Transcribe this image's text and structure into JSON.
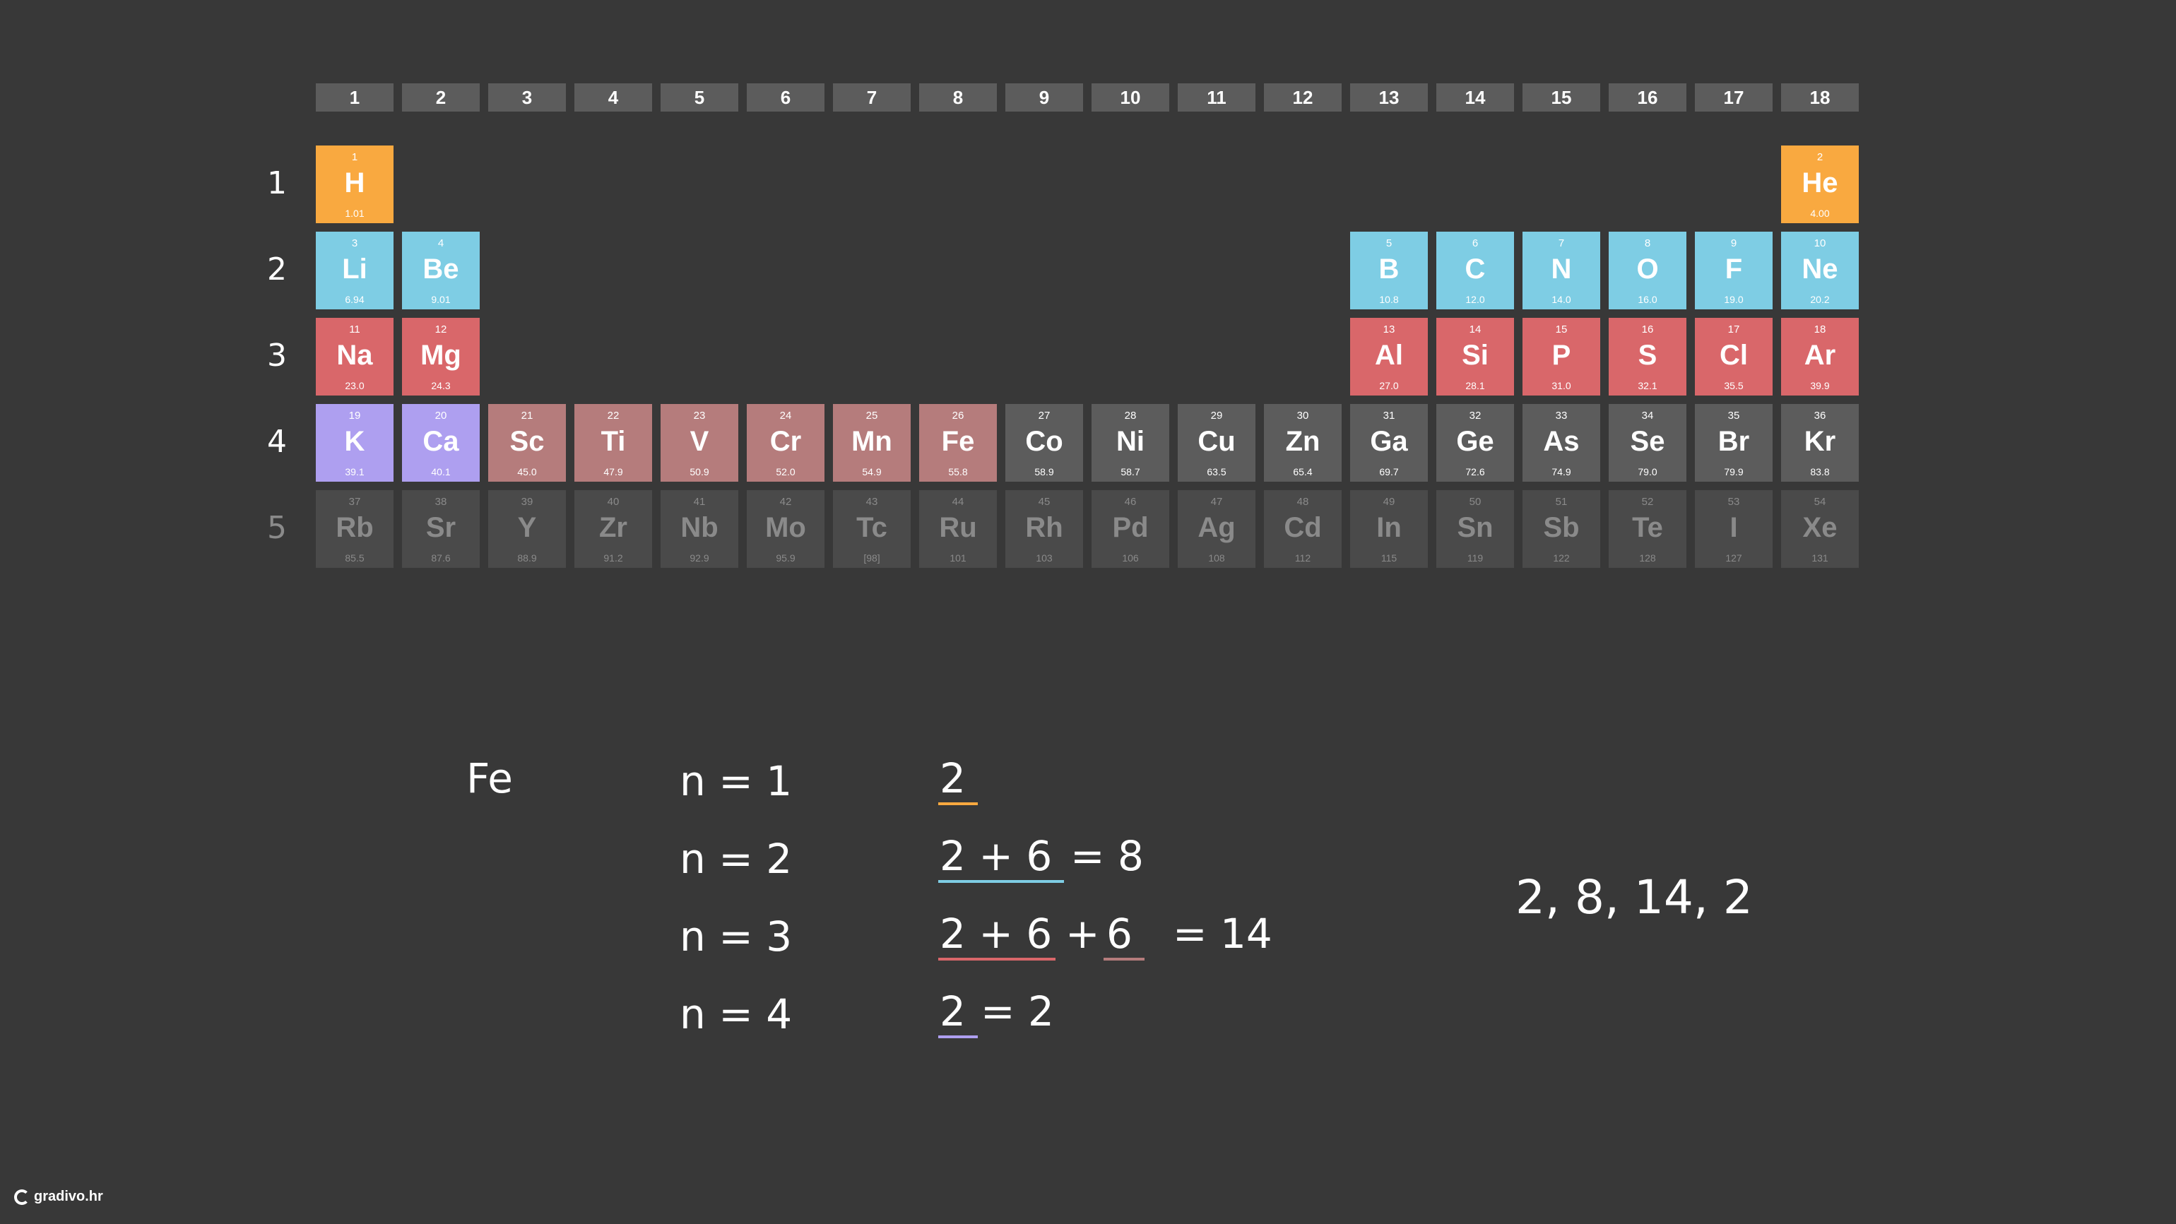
{
  "colors": {
    "background": "#383838",
    "header": "#5c5c5c",
    "orange": "#f9a940",
    "blue": "#7ecde4",
    "red": "#d9676a",
    "purple": "#ae9ff0",
    "rose": "#b57c7c",
    "gray": "#5c5c5c",
    "dimgray": "#4a4a4a"
  },
  "groups": [
    "1",
    "2",
    "3",
    "4",
    "5",
    "6",
    "7",
    "8",
    "9",
    "10",
    "11",
    "12",
    "13",
    "14",
    "15",
    "16",
    "17",
    "18"
  ],
  "periods": [
    "1",
    "2",
    "3",
    "4",
    "5"
  ],
  "elements": [
    {
      "num": "1",
      "sym": "H",
      "mass": "1.01",
      "period": 1,
      "group": 1,
      "color": "orange"
    },
    {
      "num": "2",
      "sym": "He",
      "mass": "4.00",
      "period": 1,
      "group": 18,
      "color": "orange"
    },
    {
      "num": "3",
      "sym": "Li",
      "mass": "6.94",
      "period": 2,
      "group": 1,
      "color": "blue"
    },
    {
      "num": "4",
      "sym": "Be",
      "mass": "9.01",
      "period": 2,
      "group": 2,
      "color": "blue"
    },
    {
      "num": "5",
      "sym": "B",
      "mass": "10.8",
      "period": 2,
      "group": 13,
      "color": "blue"
    },
    {
      "num": "6",
      "sym": "C",
      "mass": "12.0",
      "period": 2,
      "group": 14,
      "color": "blue"
    },
    {
      "num": "7",
      "sym": "N",
      "mass": "14.0",
      "period": 2,
      "group": 15,
      "color": "blue"
    },
    {
      "num": "8",
      "sym": "O",
      "mass": "16.0",
      "period": 2,
      "group": 16,
      "color": "blue"
    },
    {
      "num": "9",
      "sym": "F",
      "mass": "19.0",
      "period": 2,
      "group": 17,
      "color": "blue"
    },
    {
      "num": "10",
      "sym": "Ne",
      "mass": "20.2",
      "period": 2,
      "group": 18,
      "color": "blue"
    },
    {
      "num": "11",
      "sym": "Na",
      "mass": "23.0",
      "period": 3,
      "group": 1,
      "color": "red"
    },
    {
      "num": "12",
      "sym": "Mg",
      "mass": "24.3",
      "period": 3,
      "group": 2,
      "color": "red"
    },
    {
      "num": "13",
      "sym": "Al",
      "mass": "27.0",
      "period": 3,
      "group": 13,
      "color": "red"
    },
    {
      "num": "14",
      "sym": "Si",
      "mass": "28.1",
      "period": 3,
      "group": 14,
      "color": "red"
    },
    {
      "num": "15",
      "sym": "P",
      "mass": "31.0",
      "period": 3,
      "group": 15,
      "color": "red"
    },
    {
      "num": "16",
      "sym": "S",
      "mass": "32.1",
      "period": 3,
      "group": 16,
      "color": "red"
    },
    {
      "num": "17",
      "sym": "Cl",
      "mass": "35.5",
      "period": 3,
      "group": 17,
      "color": "red"
    },
    {
      "num": "18",
      "sym": "Ar",
      "mass": "39.9",
      "period": 3,
      "group": 18,
      "color": "red"
    },
    {
      "num": "19",
      "sym": "K",
      "mass": "39.1",
      "period": 4,
      "group": 1,
      "color": "purple"
    },
    {
      "num": "20",
      "sym": "Ca",
      "mass": "40.1",
      "period": 4,
      "group": 2,
      "color": "purple"
    },
    {
      "num": "21",
      "sym": "Sc",
      "mass": "45.0",
      "period": 4,
      "group": 3,
      "color": "rose"
    },
    {
      "num": "22",
      "sym": "Ti",
      "mass": "47.9",
      "period": 4,
      "group": 4,
      "color": "rose"
    },
    {
      "num": "23",
      "sym": "V",
      "mass": "50.9",
      "period": 4,
      "group": 5,
      "color": "rose"
    },
    {
      "num": "24",
      "sym": "Cr",
      "mass": "52.0",
      "period": 4,
      "group": 6,
      "color": "rose"
    },
    {
      "num": "25",
      "sym": "Mn",
      "mass": "54.9",
      "period": 4,
      "group": 7,
      "color": "rose"
    },
    {
      "num": "26",
      "sym": "Fe",
      "mass": "55.8",
      "period": 4,
      "group": 8,
      "color": "rose"
    },
    {
      "num": "27",
      "sym": "Co",
      "mass": "58.9",
      "period": 4,
      "group": 9,
      "color": "gray"
    },
    {
      "num": "28",
      "sym": "Ni",
      "mass": "58.7",
      "period": 4,
      "group": 10,
      "color": "gray"
    },
    {
      "num": "29",
      "sym": "Cu",
      "mass": "63.5",
      "period": 4,
      "group": 11,
      "color": "gray"
    },
    {
      "num": "30",
      "sym": "Zn",
      "mass": "65.4",
      "period": 4,
      "group": 12,
      "color": "gray"
    },
    {
      "num": "31",
      "sym": "Ga",
      "mass": "69.7",
      "period": 4,
      "group": 13,
      "color": "gray"
    },
    {
      "num": "32",
      "sym": "Ge",
      "mass": "72.6",
      "period": 4,
      "group": 14,
      "color": "gray"
    },
    {
      "num": "33",
      "sym": "As",
      "mass": "74.9",
      "period": 4,
      "group": 15,
      "color": "gray"
    },
    {
      "num": "34",
      "sym": "Se",
      "mass": "79.0",
      "period": 4,
      "group": 16,
      "color": "gray"
    },
    {
      "num": "35",
      "sym": "Br",
      "mass": "79.9",
      "period": 4,
      "group": 17,
      "color": "gray"
    },
    {
      "num": "36",
      "sym": "Kr",
      "mass": "83.8",
      "period": 4,
      "group": 18,
      "color": "gray"
    },
    {
      "num": "37",
      "sym": "Rb",
      "mass": "85.5",
      "period": 5,
      "group": 1,
      "color": "dimgray"
    },
    {
      "num": "38",
      "sym": "Sr",
      "mass": "87.6",
      "period": 5,
      "group": 2,
      "color": "dimgray"
    },
    {
      "num": "39",
      "sym": "Y",
      "mass": "88.9",
      "period": 5,
      "group": 3,
      "color": "dimgray"
    },
    {
      "num": "40",
      "sym": "Zr",
      "mass": "91.2",
      "period": 5,
      "group": 4,
      "color": "dimgray"
    },
    {
      "num": "41",
      "sym": "Nb",
      "mass": "92.9",
      "period": 5,
      "group": 5,
      "color": "dimgray"
    },
    {
      "num": "42",
      "sym": "Mo",
      "mass": "95.9",
      "period": 5,
      "group": 6,
      "color": "dimgray"
    },
    {
      "num": "43",
      "sym": "Tc",
      "mass": "[98]",
      "period": 5,
      "group": 7,
      "color": "dimgray"
    },
    {
      "num": "44",
      "sym": "Ru",
      "mass": "101",
      "period": 5,
      "group": 8,
      "color": "dimgray"
    },
    {
      "num": "45",
      "sym": "Rh",
      "mass": "103",
      "period": 5,
      "group": 9,
      "color": "dimgray"
    },
    {
      "num": "46",
      "sym": "Pd",
      "mass": "106",
      "period": 5,
      "group": 10,
      "color": "dimgray"
    },
    {
      "num": "47",
      "sym": "Ag",
      "mass": "108",
      "period": 5,
      "group": 11,
      "color": "dimgray"
    },
    {
      "num": "48",
      "sym": "Cd",
      "mass": "112",
      "period": 5,
      "group": 12,
      "color": "dimgray"
    },
    {
      "num": "49",
      "sym": "In",
      "mass": "115",
      "period": 5,
      "group": 13,
      "color": "dimgray"
    },
    {
      "num": "50",
      "sym": "Sn",
      "mass": "119",
      "period": 5,
      "group": 14,
      "color": "dimgray"
    },
    {
      "num": "51",
      "sym": "Sb",
      "mass": "122",
      "period": 5,
      "group": 15,
      "color": "dimgray"
    },
    {
      "num": "52",
      "sym": "Te",
      "mass": "128",
      "period": 5,
      "group": 16,
      "color": "dimgray"
    },
    {
      "num": "53",
      "sym": "I",
      "mass": "127",
      "period": 5,
      "group": 17,
      "color": "dimgray"
    },
    {
      "num": "54",
      "sym": "Xe",
      "mass": "131",
      "period": 5,
      "group": 18,
      "color": "dimgray"
    }
  ],
  "notes": {
    "element": "Fe",
    "shells": [
      "n = 1",
      "n = 2",
      "n = 3",
      "n = 4"
    ],
    "counts": {
      "n1": "2",
      "n2_a": "2 + 6",
      "n2_b": "= 8",
      "n3_a": "2 + 6",
      "n3_plus": "+",
      "n3_b": "6",
      "n3_c": "= 14",
      "n4_a": "2",
      "n4_b": "= 2"
    },
    "result": "2, 8, 14, 2"
  },
  "logo": "gradivo.hr"
}
